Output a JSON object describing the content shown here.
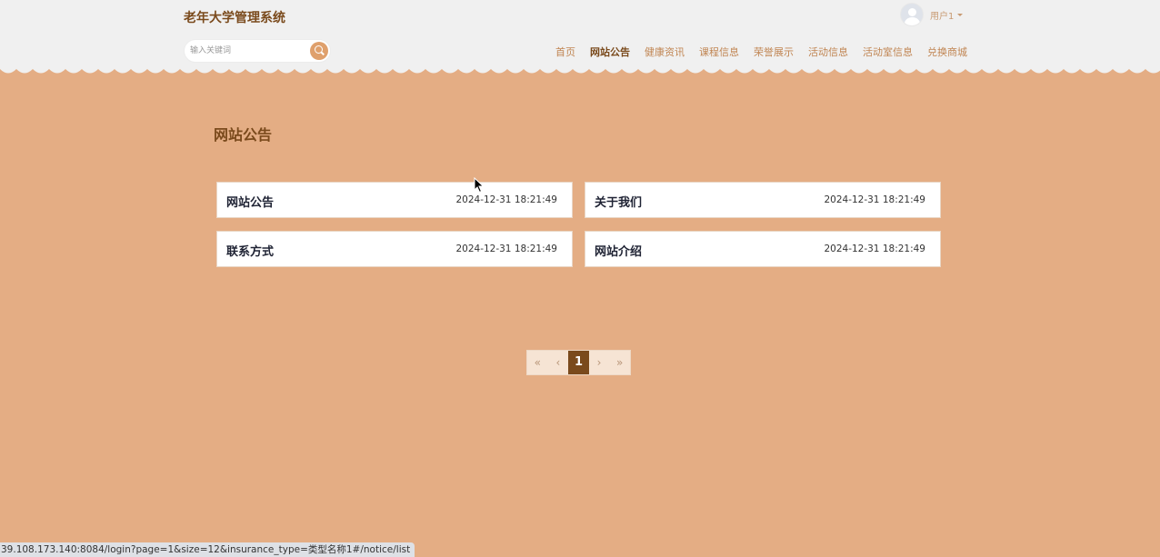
{
  "header": {
    "site_title": "老年大学管理系统",
    "user_name": "用户1",
    "search_placeholder": "输入关键词"
  },
  "nav": [
    {
      "label": "首页",
      "active": false
    },
    {
      "label": "网站公告",
      "active": true
    },
    {
      "label": "健康资讯",
      "active": false
    },
    {
      "label": "课程信息",
      "active": false
    },
    {
      "label": "荣誉展示",
      "active": false
    },
    {
      "label": "活动信息",
      "active": false
    },
    {
      "label": "活动室信息",
      "active": false
    },
    {
      "label": "兑换商城",
      "active": false
    }
  ],
  "page": {
    "title": "网站公告"
  },
  "notices": [
    {
      "title": "网站公告",
      "time": "2024-12-31 18:21:49"
    },
    {
      "title": "关于我们",
      "time": "2024-12-31 18:21:49"
    },
    {
      "title": "联系方式",
      "time": "2024-12-31 18:21:49"
    },
    {
      "title": "网站介绍",
      "time": "2024-12-31 18:21:49"
    }
  ],
  "pagination": {
    "first": "«",
    "prev": "‹",
    "current": "1",
    "next": "›",
    "last": "»"
  },
  "status_bar": {
    "url": "39.108.173.140:8084/login?page=1&size=12&insurance_type=类型名称1#/notice/list"
  },
  "colors": {
    "background": "#e4ad84",
    "header_bg": "#f0f0f0",
    "brand_dark": "#7a4a1c",
    "nav_text": "#c08552",
    "search_button": "#dfa06c"
  },
  "icons": {
    "search": "search-icon",
    "avatar": "user-avatar-icon",
    "dropdown": "chevron-down-icon"
  }
}
